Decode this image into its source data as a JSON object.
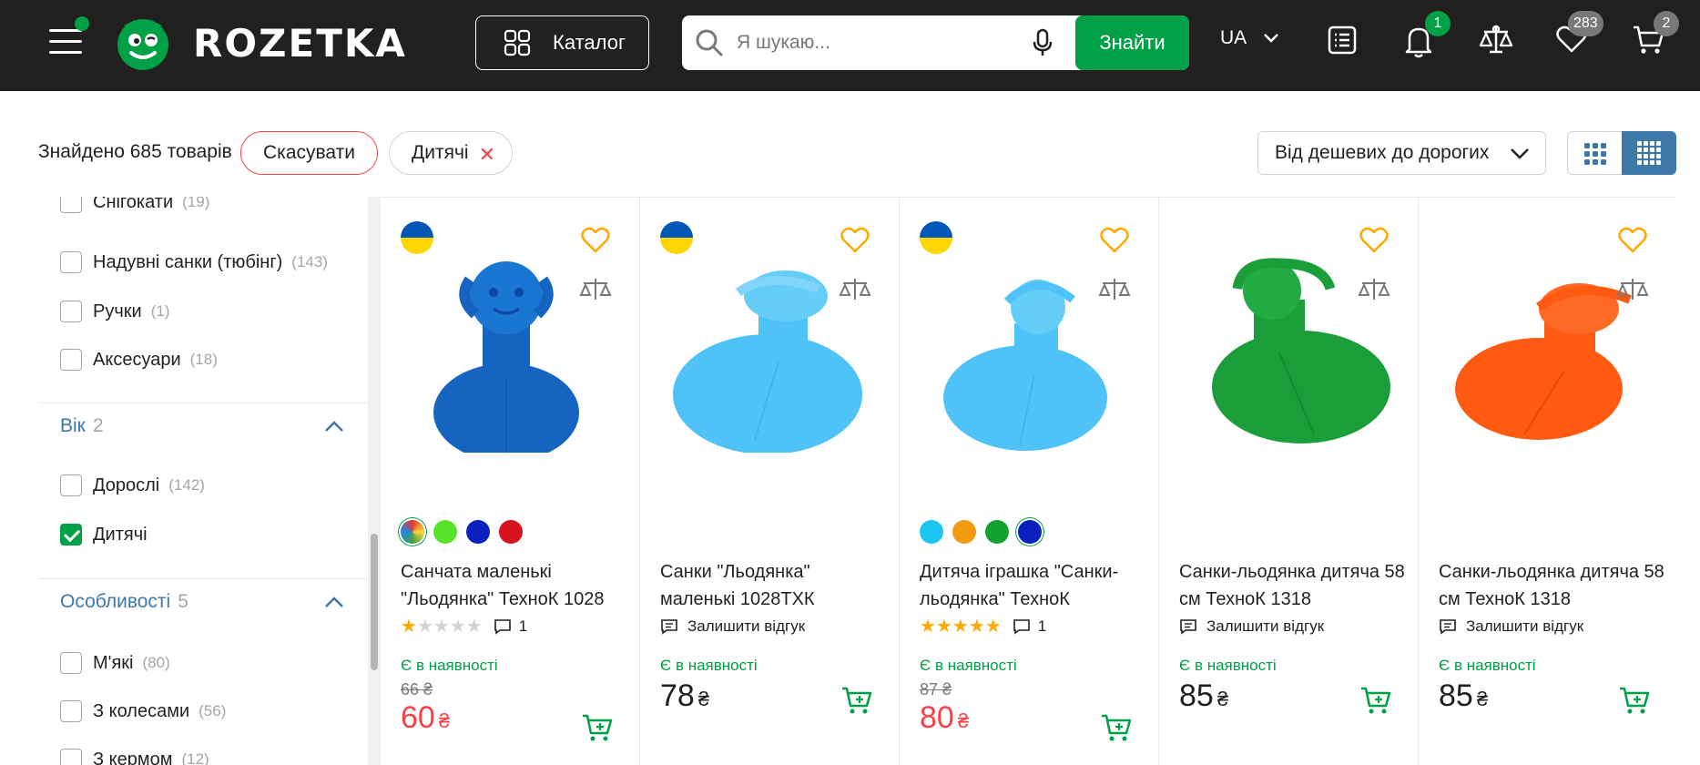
{
  "header": {
    "logo_text": "ROZETKA",
    "catalog_label": "Каталог",
    "search_placeholder": "Я шукаю...",
    "search_button": "Знайти",
    "lang": "UA",
    "notifications_count": "1",
    "wishlist_count": "283",
    "cart_count": "2",
    "accent": "#00a046",
    "bg": "#221f1f"
  },
  "filters": {
    "found_text": "Знайдено 685 товарів",
    "cancel_label": "Скасувати",
    "active_chip": "Дитячі",
    "sort_label": "Від дешевих до дорогих"
  },
  "sidebar": {
    "partial_item": "Снігокати",
    "partial_count": "(19)",
    "items_top": [
      {
        "label": "Надувні санки (тюбінг)",
        "count": "(143)"
      },
      {
        "label": "Ручки",
        "count": "(1)"
      },
      {
        "label": "Аксесуари",
        "count": "(18)"
      }
    ],
    "age": {
      "title": "Вік",
      "num": "2",
      "items": [
        {
          "label": "Дорослі",
          "count": "(142)",
          "checked": false
        },
        {
          "label": "Дитячі",
          "count": "",
          "checked": true
        }
      ]
    },
    "features": {
      "title": "Особливості",
      "num": "5",
      "items": [
        {
          "label": "М'які",
          "count": "(80)"
        },
        {
          "label": "З колесами",
          "count": "(56)"
        },
        {
          "label": "З кермом",
          "count": "(12)"
        }
      ]
    }
  },
  "products": [
    {
      "title": "Санчата маленькі \"Льодянка\" ТехноК 1028",
      "rating": 1,
      "reviews": "1",
      "availability": "Є в наявності",
      "old_price": "66 ₴",
      "price": "60",
      "currency": "₴",
      "color": "#1565c0",
      "swatches": [
        "multi",
        "#57e32c",
        "#0a1fbf",
        "#d7131b"
      ]
    },
    {
      "title": "Санки \"Льодянка\" маленькі 1028ТХК",
      "review_label": "Залишити відгук",
      "availability": "Є в наявності",
      "price": "78",
      "currency": "₴",
      "color": "#4fc3f7"
    },
    {
      "title": "Дитяча іграшка \"Санки-льодянка\" ТехноК",
      "rating": 5,
      "reviews": "1",
      "availability": "Є в наявності",
      "old_price": "87 ₴",
      "price": "80",
      "currency": "₴",
      "color": "#4fc3f7",
      "swatches": [
        "#1bc7f0",
        "#f39c12",
        "#10a22f",
        "#0a1fbf"
      ]
    },
    {
      "title": "Санки-льодянка дитяча 58 см ТехноК 1318",
      "review_label": "Залишити відгук",
      "availability": "Є в наявності",
      "price": "85",
      "currency": "₴",
      "color": "#1b9e3a"
    },
    {
      "title": "Санки-льодянка дитяча 58 см ТехноК 1318",
      "review_label": "Залишити відгук",
      "availability": "Є в наявності",
      "price": "85",
      "currency": "₴",
      "color": "#ff5a12"
    }
  ]
}
